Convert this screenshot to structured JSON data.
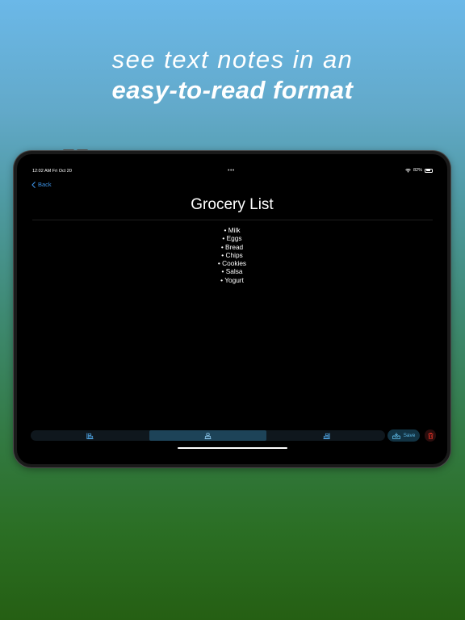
{
  "headline": {
    "line1": "see text notes in an",
    "line2": "easy-to-read format"
  },
  "status_bar": {
    "time": "12:02 AM   Fri Oct 20",
    "dots": "•••",
    "battery": "82%",
    "battery_level": 0.82,
    "wifi_icon": "wifi-icon",
    "battery_icon": "battery-icon"
  },
  "nav": {
    "back_label": "Back",
    "back_icon": "chevron-left-icon"
  },
  "note": {
    "title": "Grocery List",
    "items": [
      "Milk",
      "Eggs",
      "Bread",
      "Chips",
      "Cookies",
      "Salsa",
      "Yogurt"
    ]
  },
  "toolbar": {
    "buttons": [
      {
        "icon": "align-left-icon",
        "active": false
      },
      {
        "icon": "align-center-icon",
        "active": true
      },
      {
        "icon": "align-right-icon",
        "active": false
      }
    ],
    "save_label": "Save",
    "save_icon": "tray-download-icon",
    "delete_icon": "trash-icon"
  },
  "colors": {
    "accent": "#3b8fe0",
    "save_text": "#5bb4e0",
    "active_segment": "#1d4358",
    "delete": "#d93025",
    "screen_bg": "#000000"
  }
}
